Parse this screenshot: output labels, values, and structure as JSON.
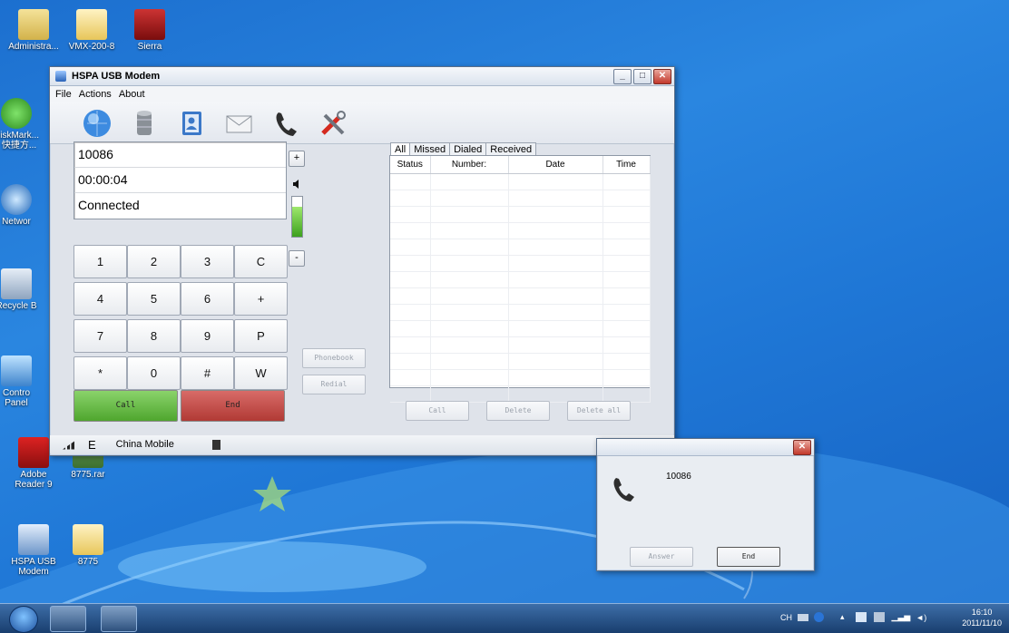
{
  "desktop": {
    "icons": [
      {
        "label": "Administra..."
      },
      {
        "label": "VMX-200-8"
      },
      {
        "label": "Sierra"
      },
      {
        "label": "DiskMark..."
      },
      {
        "label": "- 快捷方..."
      },
      {
        "label": "Networ"
      },
      {
        "label": "Recycle B"
      },
      {
        "label": "Contro"
      },
      {
        "label": "Panel"
      },
      {
        "label": "Adobe"
      },
      {
        "label": "Reader 9"
      },
      {
        "label": "8775.rar"
      },
      {
        "label": "HSPA USB"
      },
      {
        "label": "Modem"
      },
      {
        "label": "8775"
      }
    ]
  },
  "main_window": {
    "title": "HSPA USB Modem",
    "menu": [
      "File",
      "Actions",
      "About"
    ],
    "toolbar_icons": [
      "globe-icon",
      "database-icon",
      "contacts-icon",
      "envelope-icon",
      "phone-icon",
      "tools-icon"
    ],
    "display": {
      "number": "10086",
      "timer": "00:00:04",
      "status": "Connected"
    },
    "volume_level": 0.75,
    "keypad": [
      "1",
      "2",
      "3",
      "C",
      "4",
      "5",
      "6",
      "+",
      "7",
      "8",
      "9",
      "P",
      "*",
      "0",
      "#",
      "W"
    ],
    "call_label": "Call",
    "end_label": "End",
    "phonebook_label": "Phonebook",
    "redial_label": "Redial",
    "tabs": [
      "All",
      "Missed",
      "Dialed",
      "Received"
    ],
    "log_headers": [
      "Status",
      "Number:",
      "Date",
      "Time"
    ],
    "log_call_label": "Call",
    "log_delete_label": "Delete",
    "log_delete_all_label": "Delete all",
    "status": {
      "network_type": "E",
      "carrier": "China Mobile"
    }
  },
  "popup": {
    "number": "10086",
    "answer_label": "Answer",
    "end_label": "End"
  },
  "taskbar": {
    "tray_lang": "CH",
    "time": "16:10",
    "date": "2011/11/10"
  }
}
